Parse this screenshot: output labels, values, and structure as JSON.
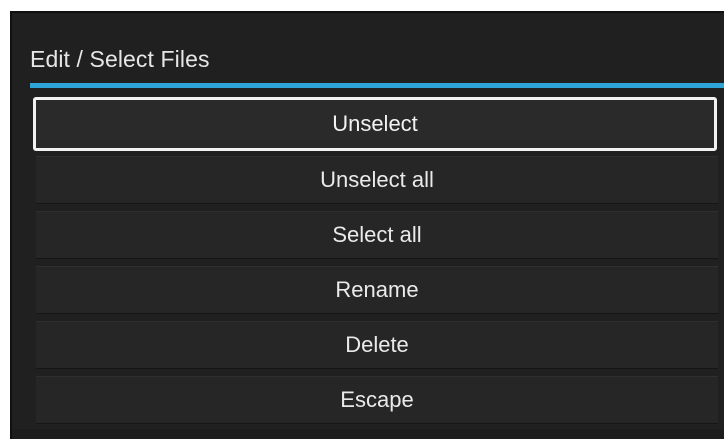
{
  "dialog": {
    "title": "Edit / Select Files",
    "accent_color": "#2fa4d6",
    "background_color": "#202020"
  },
  "menu": {
    "selected_index": 0,
    "items": [
      {
        "label": "Unselect"
      },
      {
        "label": "Unselect all"
      },
      {
        "label": "Select all"
      },
      {
        "label": "Rename"
      },
      {
        "label": "Delete"
      },
      {
        "label": "Escape"
      }
    ]
  }
}
